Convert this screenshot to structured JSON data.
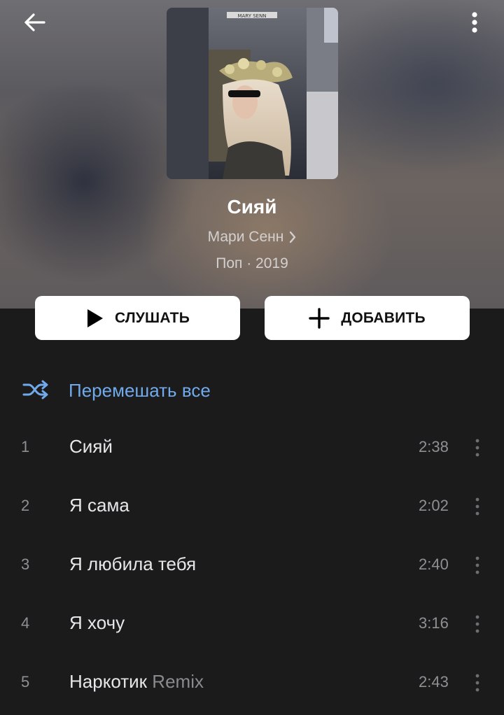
{
  "header": {
    "back_icon": "arrow-left-icon",
    "more_icon": "vertical-dots-icon",
    "cover_text": "MARY SENN"
  },
  "album": {
    "title": "Сияй",
    "artist": "Мари Сенн",
    "meta": "Поп · 2019"
  },
  "actions": {
    "play_label": "СЛУШАТЬ",
    "add_label": "ДОБАВИТЬ"
  },
  "shuffle": {
    "label": "Перемешать все"
  },
  "colors": {
    "accent": "#71aaeb",
    "background": "#1b1b1c",
    "button_bg": "#ffffff"
  },
  "tracks": [
    {
      "number": "1",
      "title": "Сияй",
      "subtitle": "",
      "duration": "2:38"
    },
    {
      "number": "2",
      "title": "Я сама",
      "subtitle": "",
      "duration": "2:02"
    },
    {
      "number": "3",
      "title": "Я любила тебя",
      "subtitle": "",
      "duration": "2:40"
    },
    {
      "number": "4",
      "title": "Я хочу",
      "subtitle": "",
      "duration": "3:16"
    },
    {
      "number": "5",
      "title": "Наркотик",
      "subtitle": "Remix",
      "duration": "2:43"
    }
  ]
}
